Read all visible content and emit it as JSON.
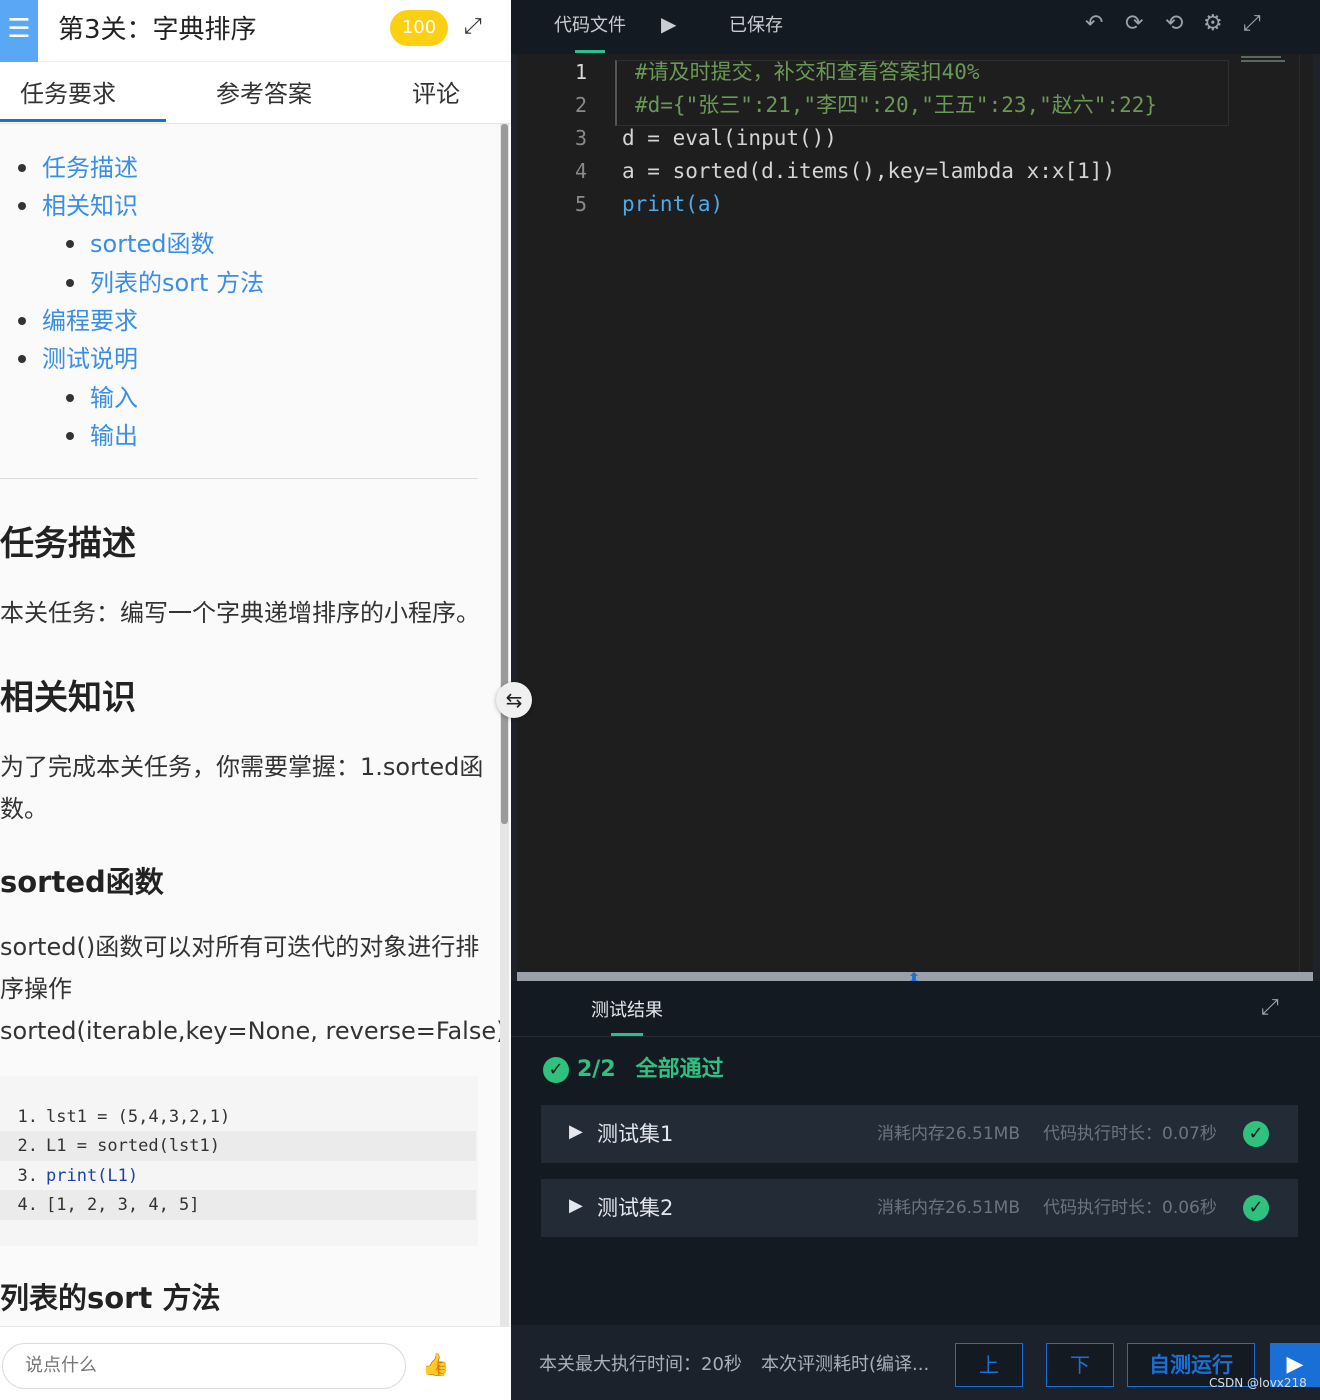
{
  "left": {
    "title": "第3关：字典排序",
    "score": "100",
    "tabs": [
      "任务要求",
      "参考答案",
      "评论"
    ],
    "toc": {
      "items": [
        {
          "label": "任务描述",
          "level": 1
        },
        {
          "label": "相关知识",
          "level": 1
        },
        {
          "label": "sorted函数",
          "level": 2
        },
        {
          "label": "列表的sort 方法",
          "level": 2
        },
        {
          "label": "编程要求",
          "level": 1
        },
        {
          "label": "测试说明",
          "level": 1
        },
        {
          "label": "输入",
          "level": 2
        },
        {
          "label": "输出",
          "level": 2
        }
      ]
    },
    "content": {
      "h_task": "任务描述",
      "p_task": "本关任务：编写一个字典递增排序的小程序。",
      "h_knowledge": "相关知识",
      "p_knowledge_1": "为了完成本关任务，你需要掌握：1.sorted函",
      "p_knowledge_2": "数。",
      "h_sorted": "sorted函数",
      "p_sorted_1": "sorted()函数可以对所有可迭代的对象进行排",
      "p_sorted_2": "序操作",
      "p_sorted_3": "sorted(iterable,key=None, reverse=False)",
      "code": [
        {
          "num": "1.",
          "text": "lst1 = (5,4,3,2,1)"
        },
        {
          "num": "2.",
          "text": "L1 = sorted(lst1)"
        },
        {
          "num": "3.",
          "text": "print(L1)"
        },
        {
          "num": "4.",
          "text": "[1, 2, 3, 4, 5]"
        }
      ],
      "h_sort": "列表的sort 方法"
    },
    "comment_placeholder": "说点什么"
  },
  "right": {
    "toolbar": {
      "code_file": "代码文件",
      "saved": "已保存"
    },
    "editor": {
      "line_numbers": [
        "1",
        "2",
        "3",
        "4",
        "5"
      ],
      "lines": [
        "#请及时提交，补交和查看答案扣40%",
        "#d={\"张三\":21,\"李四\":20,\"王五\":23,\"赵六\":22}",
        "d = eval(input())",
        "a = sorted(d.items(),key=lambda x:x[1])",
        "print(a)"
      ]
    },
    "results": {
      "title": "测试结果",
      "summary_count": "2/2",
      "summary_text": "全部通过",
      "sets": [
        {
          "name": "测试集1",
          "memory": "消耗内存26.51MB",
          "time": "代码执行时长：0.07秒"
        },
        {
          "name": "测试集2",
          "memory": "消耗内存26.51MB",
          "time": "代码执行时长：0.06秒"
        }
      ]
    },
    "bottom": {
      "max_time": "本关最大执行时间：20秒",
      "eval_time": "本次评测耗时(编译...",
      "prev": "上",
      "next": "下",
      "self_test": "自测运行"
    },
    "watermark": "CSDN @lovx218"
  },
  "colors": {
    "accent": "#1a6fd6",
    "success": "#2ec27e",
    "score_badge": "#fcd012",
    "link": "#3a8ee6"
  }
}
